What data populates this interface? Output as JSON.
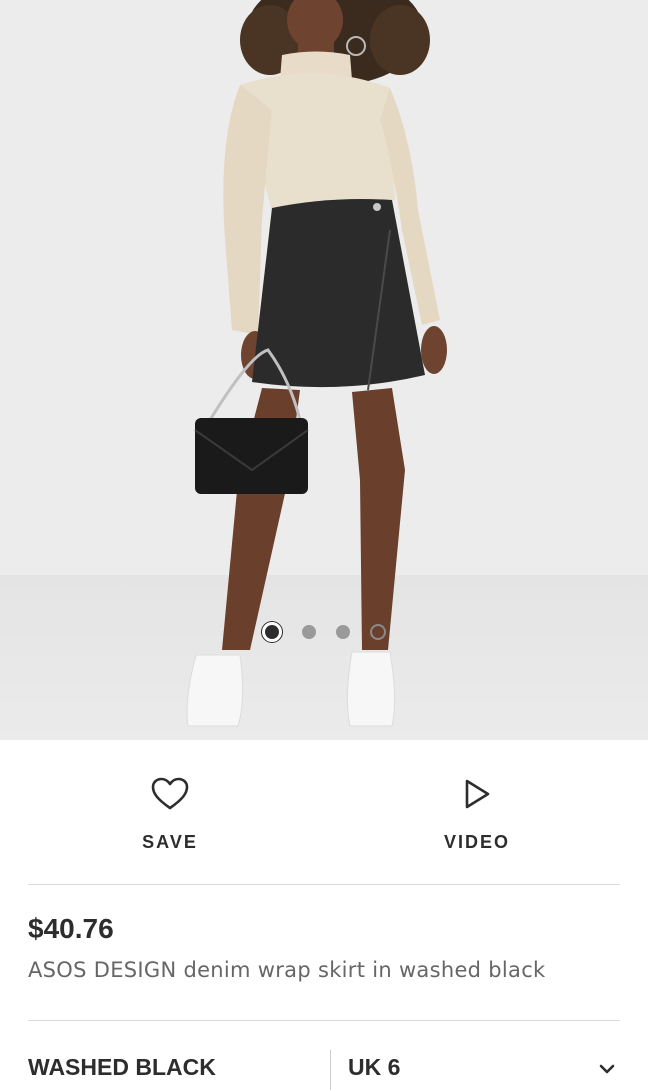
{
  "gallery": {
    "image_description_icon": "product-photo",
    "dots": [
      "image-1",
      "image-2",
      "image-3",
      "video"
    ],
    "active_index": 0
  },
  "actions": {
    "save_label": "SAVE",
    "video_label": "VIDEO"
  },
  "product": {
    "price": "$40.76",
    "title": "ASOS DESIGN denim wrap skirt in washed black"
  },
  "selectors": {
    "colour": "WASHED BLACK",
    "size": "UK 6"
  },
  "colors": {
    "text": "#2d2d2d",
    "muted": "#666666",
    "background": "#ffffff"
  }
}
